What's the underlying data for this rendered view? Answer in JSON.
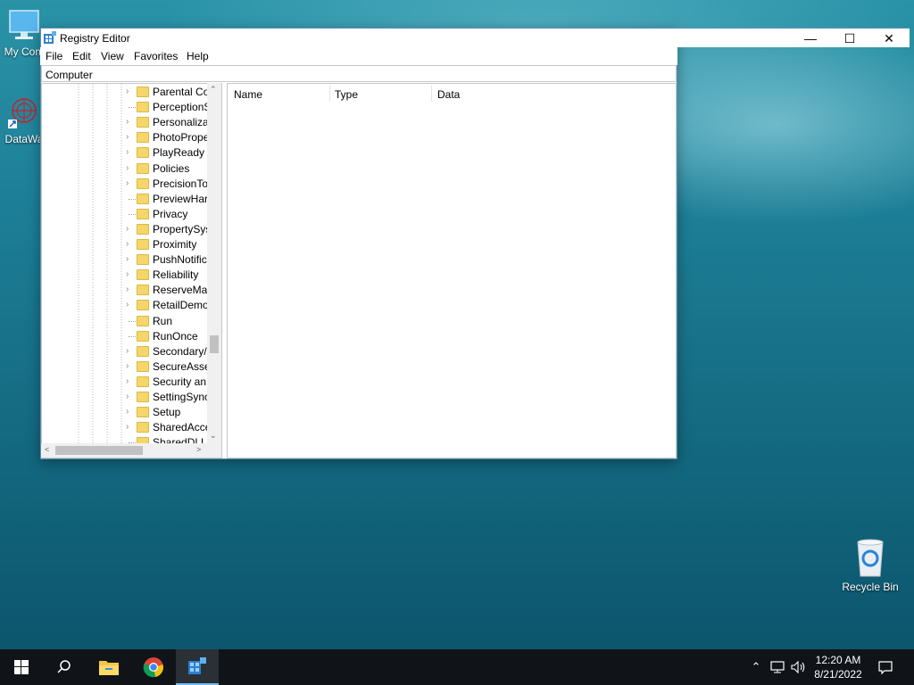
{
  "desktop": {
    "icons": [
      {
        "label": "My Com"
      },
      {
        "label": "DataWa"
      },
      {
        "label": "Recycle Bin"
      }
    ]
  },
  "window": {
    "title": "Registry Editor",
    "controls": {
      "minimize": "—",
      "maximize": "☐",
      "close": "✕"
    }
  },
  "menu": {
    "file": "File",
    "edit": "Edit",
    "view": "View",
    "favorites": "Favorites",
    "help": "Help"
  },
  "address": {
    "path": "Computer"
  },
  "tree": {
    "items": [
      {
        "label": "Parental Co",
        "expandable": true
      },
      {
        "label": "PerceptionS",
        "expandable": false
      },
      {
        "label": "Personaliza",
        "expandable": true
      },
      {
        "label": "PhotoPrope",
        "expandable": true
      },
      {
        "label": "PlayReady",
        "expandable": true
      },
      {
        "label": "Policies",
        "expandable": true
      },
      {
        "label": "PrecisionTo",
        "expandable": true
      },
      {
        "label": "PreviewHar",
        "expandable": false
      },
      {
        "label": "Privacy",
        "expandable": false
      },
      {
        "label": "PropertySys",
        "expandable": true
      },
      {
        "label": "Proximity",
        "expandable": true
      },
      {
        "label": "PushNotific",
        "expandable": true
      },
      {
        "label": "Reliability",
        "expandable": true
      },
      {
        "label": "ReserveMar",
        "expandable": true
      },
      {
        "label": "RetailDemo",
        "expandable": true
      },
      {
        "label": "Run",
        "expandable": false
      },
      {
        "label": "RunOnce",
        "expandable": false
      },
      {
        "label": "Secondary/",
        "expandable": true
      },
      {
        "label": "SecureAsse",
        "expandable": true
      },
      {
        "label": "Security an",
        "expandable": true
      },
      {
        "label": "SettingSync",
        "expandable": true
      },
      {
        "label": "Setup",
        "expandable": true
      },
      {
        "label": "SharedAcce",
        "expandable": true
      },
      {
        "label": "SharedDLLs",
        "expandable": false
      }
    ]
  },
  "values": {
    "columns": {
      "name": "Name",
      "type": "Type",
      "data": "Data"
    }
  },
  "taskbar": {
    "clock_time": "12:20 AM",
    "clock_date": "8/21/2022"
  }
}
